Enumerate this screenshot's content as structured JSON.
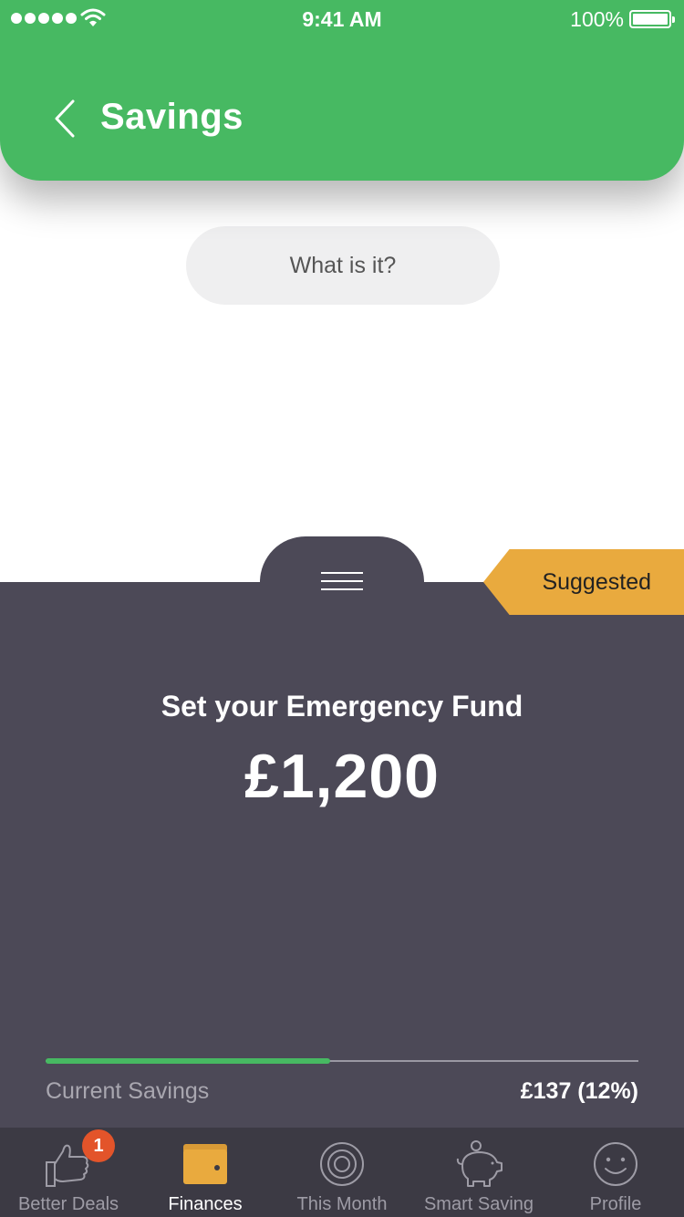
{
  "status_bar": {
    "time": "9:41 AM",
    "battery": "100%"
  },
  "header": {
    "title": "Savings"
  },
  "info_button": {
    "label": "What is it?"
  },
  "panel": {
    "badge": "Suggested",
    "heading": "Set your Emergency Fund",
    "amount": "£1,200",
    "progress": 0.48,
    "current_label": "Current Savings",
    "current_value": "£137 (12%)"
  },
  "tabs": [
    {
      "label": "Better Deals",
      "icon": "thumbs-up-icon",
      "badge": "1"
    },
    {
      "label": "Finances",
      "icon": "wallet-icon",
      "active": true
    },
    {
      "label": "This Month",
      "icon": "target-icon"
    },
    {
      "label": "Smart Saving",
      "icon": "piggy-bank-icon"
    },
    {
      "label": "Profile",
      "icon": "smiley-icon"
    }
  ],
  "colors": {
    "brand_green": "#47b962",
    "panel": "#4c4957",
    "tabbar": "#3c3a44",
    "accent_orange": "#e9aa3e",
    "badge_red": "#e3542a"
  }
}
